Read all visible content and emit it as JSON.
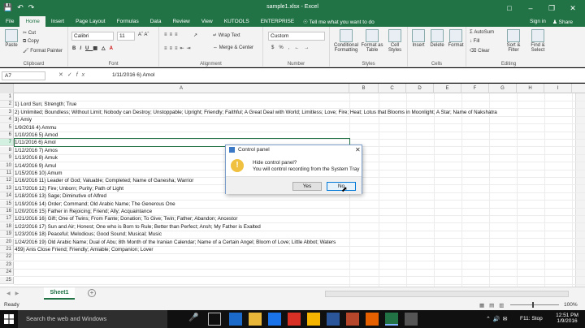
{
  "window": {
    "title": "sample1.xlsx - Excel"
  },
  "tabs": [
    "File",
    "Home",
    "Insert",
    "Page Layout",
    "Formulas",
    "Data",
    "Review",
    "View",
    "KUTOOLS",
    "ENTERPRISE"
  ],
  "tell_me": "Tell me what you want to do",
  "sign_in": "Sign in",
  "share": "Share",
  "clipboard": {
    "paste": "Paste",
    "cut": "Cut",
    "copy": "Copy",
    "format_painter": "Format Painter",
    "label": "Clipboard"
  },
  "font": {
    "name": "Calibri",
    "size": "11",
    "label": "Font"
  },
  "alignment": {
    "wrap": "Wrap Text",
    "merge": "Merge & Center",
    "label": "Alignment"
  },
  "number": {
    "format": "Custom",
    "label": "Number"
  },
  "styles": {
    "conditional": "Conditional Formatting",
    "format_table": "Format as Table",
    "cell_styles": "Cell Styles",
    "label": "Styles"
  },
  "cells": {
    "insert": "Insert",
    "delete": "Delete",
    "format": "Format",
    "label": "Cells"
  },
  "editing": {
    "autosum": "AutoSum",
    "fill": "Fill",
    "clear": "Clear",
    "sort": "Sort & Filter",
    "find": "Find & Select",
    "label": "Editing"
  },
  "formula_bar": {
    "name_box": "A7",
    "formula": "1/11/2016  6) Amol"
  },
  "columns": [
    "A",
    "B",
    "C",
    "D",
    "E",
    "F",
    "G",
    "H",
    "I"
  ],
  "rows": [
    {
      "n": "1",
      "text": ""
    },
    {
      "n": "2",
      "text": "1)  Lord Sun; Strength; True"
    },
    {
      "n": "3",
      "text": "2)  Unlimited; Boundless; Without Limit; Nobody can Destroy; Unstoppable; Upright; Friendly; Faithful; A Great Deal with World; Limitless; Love; Fire; Heat; Lotus that Blooms in Moonlight; A Star; Name of Nakshatra"
    },
    {
      "n": "4",
      "text": "3) Amiy"
    },
    {
      "n": "5",
      "text": "1/9/2016   4) Ammu"
    },
    {
      "n": "6",
      "text": "1/10/2016  5) Amod"
    },
    {
      "n": "7",
      "text": "1/11/2016  6) Amol"
    },
    {
      "n": "8",
      "text": "1/12/2016  7) Amos"
    },
    {
      "n": "9",
      "text": "1/13/2016  8) Amuk"
    },
    {
      "n": "10",
      "text": "1/14/2016  9) Amul"
    },
    {
      "n": "11",
      "text": "1/15/2016  10) Amum"
    },
    {
      "n": "12",
      "text": "1/16/2016  11) Leader of God; Valuable; Completed; Name of Ganesha; Warrior"
    },
    {
      "n": "13",
      "text": "1/17/2016  12)  Fire; Unborn; Purity; Path of Light"
    },
    {
      "n": "14",
      "text": "1/18/2016  13)  Sage; Diminutive of Alfred"
    },
    {
      "n": "15",
      "text": "1/19/2016  14)  Order; Command; Old Arabic Name; The Generous One"
    },
    {
      "n": "16",
      "text": "1/20/2016  15)  Father in Rejoicing; Friend; Ally; Acquaintance"
    },
    {
      "n": "17",
      "text": "1/21/2016  16)  Gift; One of Twins; From Fante; Donation; To Give; Twin; Father; Abandon; Ancestor"
    },
    {
      "n": "18",
      "text": "1/22/2016  17)  Sun and Air; Honest; One who is Born to Rule; Better than Perfect; Ansh; My Father is Exalted"
    },
    {
      "n": "19",
      "text": "1/23/2016  18)  Peaceful; Melodious; Good Sound; Musical; Music"
    },
    {
      "n": "20",
      "text": "1/24/2016  19)  Old Arabic Name; Dual of Abu; 8th Month of the Iranian Calendar; Name of a Certain Angel; Bloom of Love; Little Abbot; Waters"
    },
    {
      "n": "21",
      "text": "459) Anis   Close Friend; Friendly; Amiable; Companion; Lover"
    },
    {
      "n": "22",
      "text": ""
    },
    {
      "n": "23",
      "text": ""
    },
    {
      "n": "24",
      "text": ""
    },
    {
      "n": "25",
      "text": ""
    }
  ],
  "sheet_tab": "Sheet1",
  "status": {
    "ready": "Ready",
    "zoom": "100%"
  },
  "taskbar": {
    "search": "Search the web and Windows",
    "time": "12:51 PM",
    "date": "1/9/2016",
    "hotkey": "F11: Stop"
  },
  "dialog": {
    "title": "Control panel",
    "message": "Hide control panel?",
    "detail": "You will control recording from the System Tray",
    "yes": "Yes",
    "no": "No"
  },
  "colors": {
    "excel_green": "#217346",
    "accent_blue": "#0078d7"
  }
}
